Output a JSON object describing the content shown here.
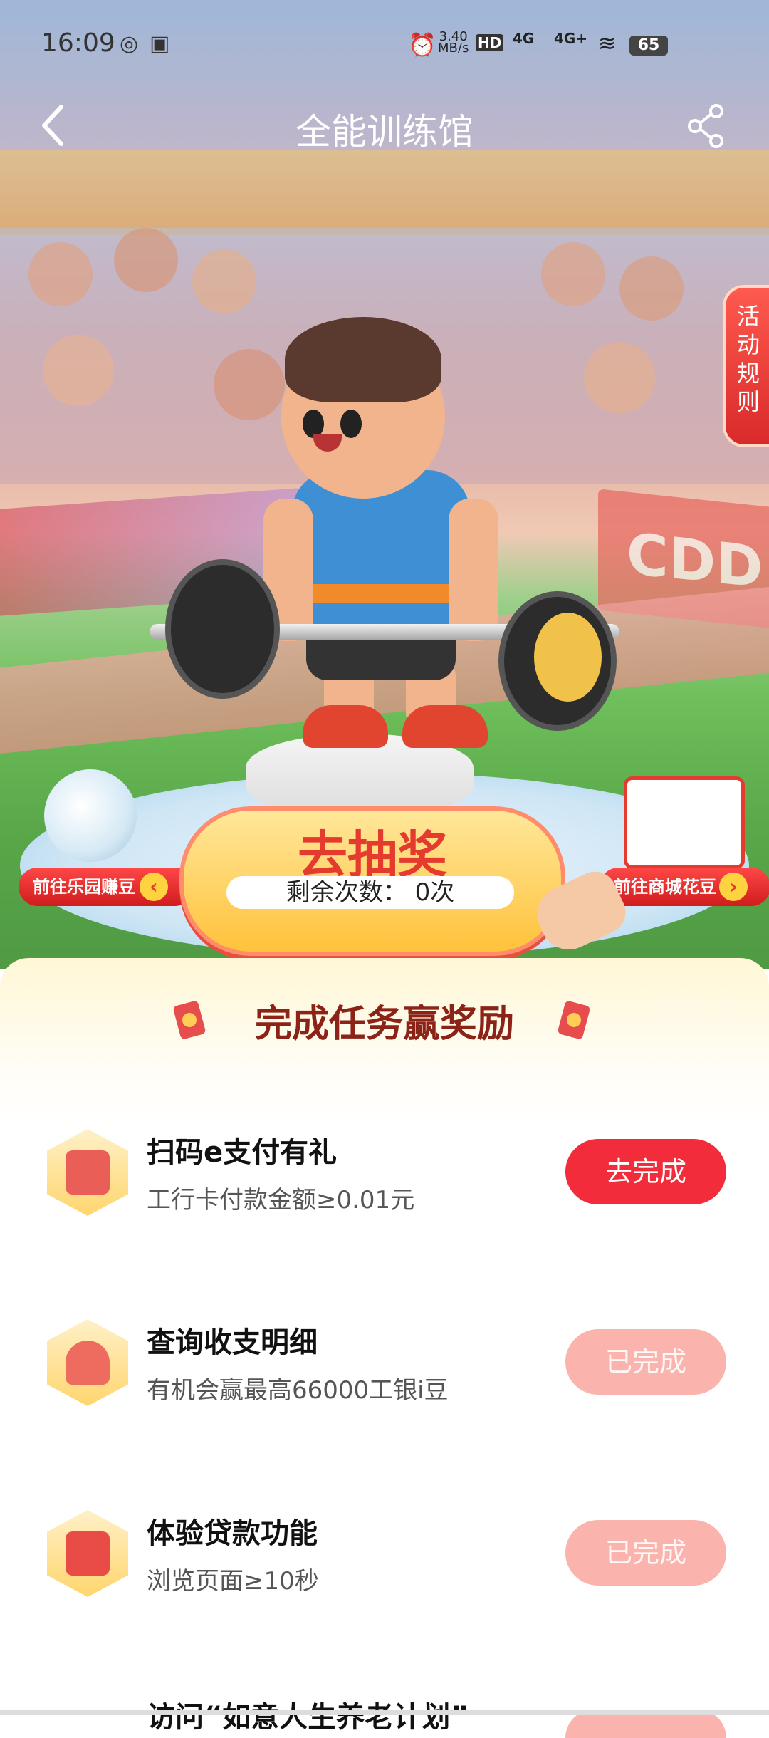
{
  "status_bar": {
    "time": "16:09",
    "net_speed_value": "3.40",
    "net_speed_unit": "MB/s",
    "hd": "HD",
    "sig1": "4G",
    "sig2": "4G+",
    "battery": "65"
  },
  "nav": {
    "title": "全能训练馆",
    "back_icon": "chevron-left-icon",
    "share_icon": "share-icon"
  },
  "rules_tab": {
    "label": "活动规则"
  },
  "hero": {
    "banner_right_text": "CDD"
  },
  "lottery": {
    "button_label": "去抽奖",
    "remaining_label": "剩余次数：",
    "remaining_value": "0次"
  },
  "side_buttons": {
    "left_label": "前往乐园赚豆",
    "right_label": "前往商城花豆"
  },
  "tasks": {
    "section_title": "完成任务赢奖励",
    "items": [
      {
        "name": "扫码e支付有礼",
        "desc": "工行卡付款金额≥0.01元",
        "button": "去完成",
        "done": false,
        "icon": "book-icon"
      },
      {
        "name": "查询收支明细",
        "desc": "有机会赢最高66000工银i豆",
        "button": "已完成",
        "done": true,
        "icon": "chart-icon"
      },
      {
        "name": "体验贷款功能",
        "desc": "浏览页面≥10秒",
        "button": "已完成",
        "done": true,
        "icon": "clipboard-icon"
      }
    ],
    "partial_item_name": "访问“如意人生养老计划”"
  }
}
